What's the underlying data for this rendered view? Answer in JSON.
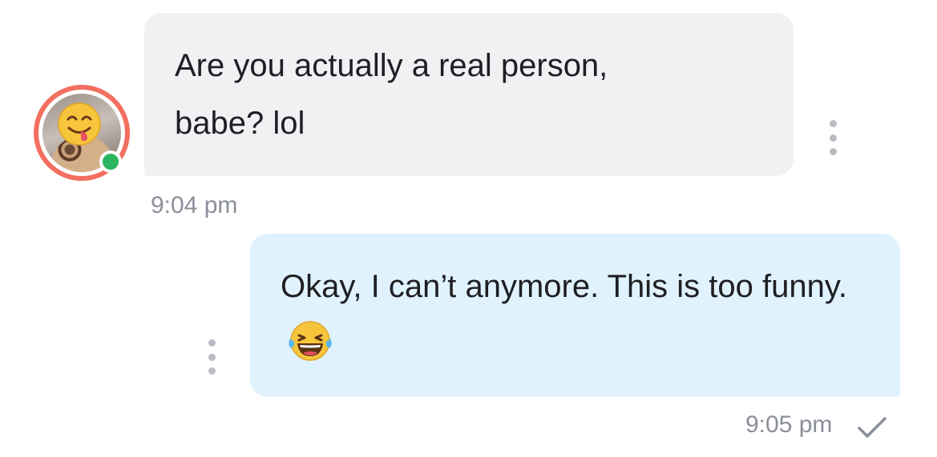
{
  "messages": {
    "incoming": {
      "text": "Are you actually a real person,\nbabe? lol",
      "time": "9:04 pm",
      "avatar_icon": "user-avatar-emoji-tongue",
      "status": "online",
      "status_color": "#2ab55e",
      "ring_color": "#f36f5f",
      "bubble_color": "#f0f1f3"
    },
    "outgoing": {
      "text": "Okay, I can’t anymore. This is too funny.",
      "emoji_icon": "laughing-tears-emoji",
      "time": "9:05 pm",
      "receipt_icon": "check-icon",
      "bubble_color": "#e0f2fd"
    }
  }
}
